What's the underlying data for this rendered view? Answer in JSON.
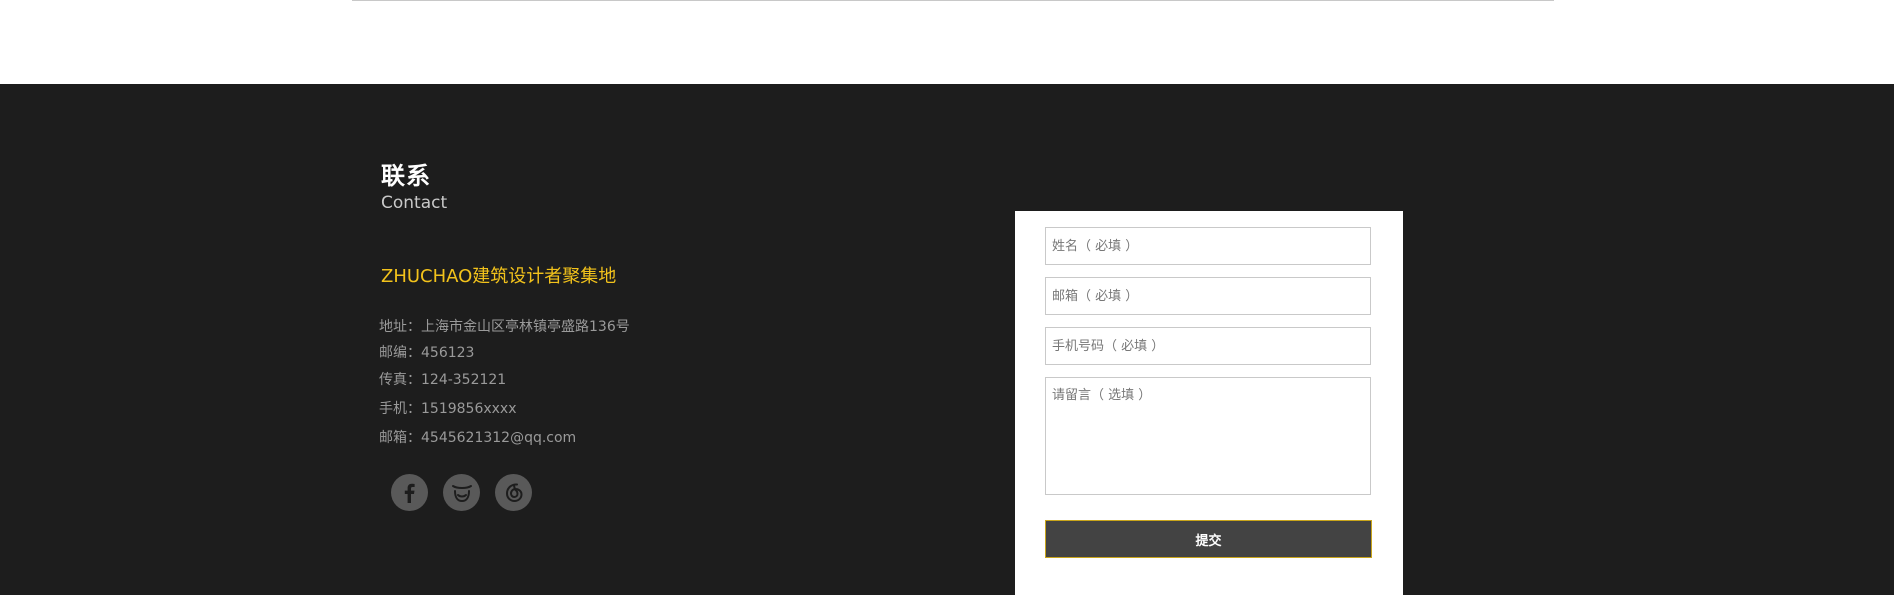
{
  "contact": {
    "heading_cn": "联系",
    "heading_en": "Contact",
    "brand": "ZHUCHAO建筑设计者聚集地",
    "info": [
      "地址：上海市金山区亭林镇亭盛路136号",
      "邮编：456123",
      "传真：124-352121",
      "手机：1519856xxxx",
      "邮箱：4545621312@qq.com"
    ],
    "social": [
      {
        "icon": "facebook-icon"
      },
      {
        "icon": "mask-icon"
      },
      {
        "icon": "netease-music-icon"
      }
    ]
  },
  "form": {
    "name_placeholder": "姓名（ 必填 ）",
    "email_placeholder": "邮箱（ 必填 ）",
    "phone_placeholder": "手机号码（ 必填 ）",
    "message_placeholder": "请留言（ 选填 ）",
    "submit_label": "提交"
  },
  "colors": {
    "footer_bg": "#1d1d1d",
    "brand_yellow": "#f2c21b",
    "social_bg": "#595959",
    "button_bg": "#434343",
    "button_border": "#c9a51b"
  }
}
